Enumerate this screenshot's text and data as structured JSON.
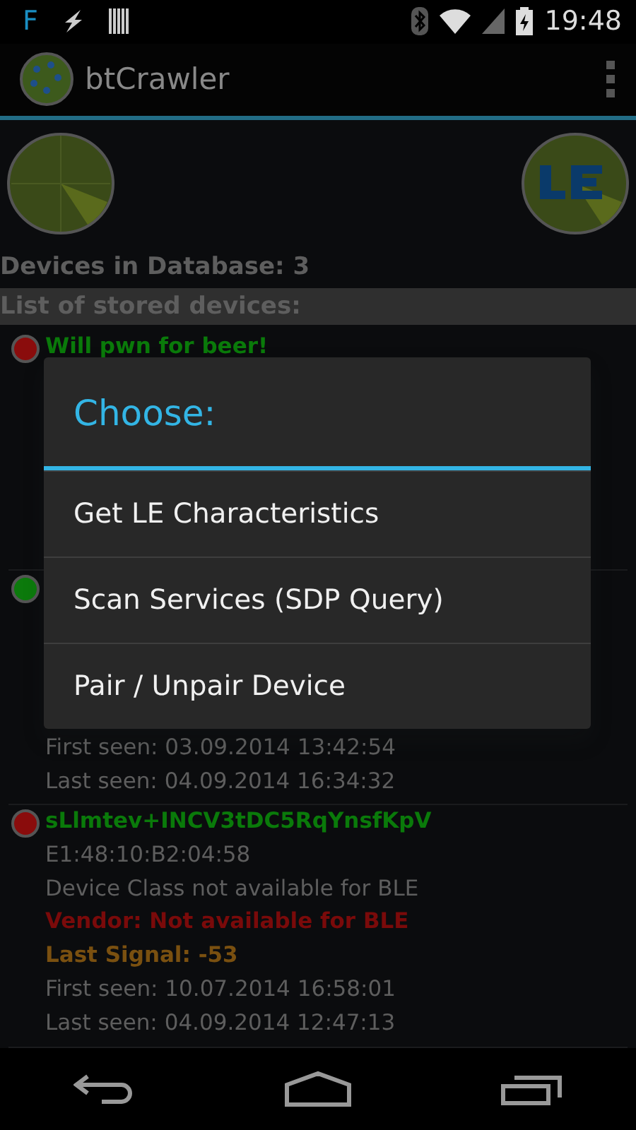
{
  "status_bar": {
    "left_icons": [
      "F"
    ],
    "time": "19:48"
  },
  "app_bar": {
    "title": "btCrawler"
  },
  "summary": "Devices in Database: 3",
  "list_header": "List of stored devices:",
  "devices": [
    {
      "color": "#8a0c0c",
      "lines": [
        {
          "kind": "name",
          "text": "Will pwn for beer!"
        }
      ]
    },
    {
      "color": "#0c7a0c",
      "lines": [
        {
          "kind": "plain",
          "text": "First seen: 03.09.2014 13:42:54"
        },
        {
          "kind": "plain",
          "text": "Last seen: 04.09.2014 16:34:32"
        }
      ]
    },
    {
      "color": "#8a0c0c",
      "lines": [
        {
          "kind": "name",
          "text": "sLlmtev+INCV3tDC5RqYnsfKpV"
        },
        {
          "kind": "plain",
          "text": "E1:48:10:B2:04:58"
        },
        {
          "kind": "plain",
          "text": "Device Class not available for BLE"
        },
        {
          "kind": "vendor",
          "text": "Vendor: Not available for BLE"
        },
        {
          "kind": "signal",
          "text": "Last Signal: -53"
        },
        {
          "kind": "plain",
          "text": "First seen: 10.07.2014 16:58:01"
        },
        {
          "kind": "plain",
          "text": "Last seen: 04.09.2014 12:47:13"
        }
      ]
    }
  ],
  "dialog": {
    "title": "Choose:",
    "items": [
      "Get LE Characteristics",
      "Scan Services (SDP Query)",
      "Pair / Unpair Device"
    ]
  }
}
